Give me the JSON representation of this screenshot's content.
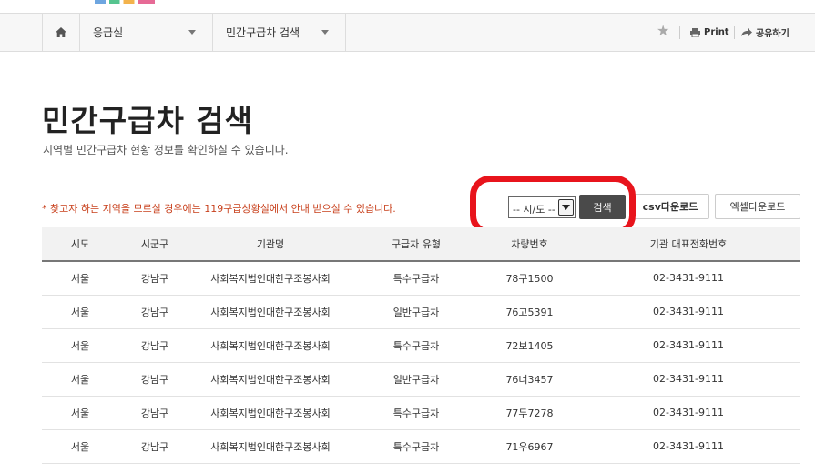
{
  "nav": {
    "home_icon": "home-icon",
    "dropdown1": "응급실",
    "dropdown2": "민간구급차 검색",
    "favorite_icon": "star-icon",
    "print_label": "Print",
    "share_label": "공유하기"
  },
  "page": {
    "title": "민간구급차 검색",
    "description": "지역별 민간구급차 현황 정보를 확인하실 수 있습니다."
  },
  "search": {
    "notice": "* 찾고자 하는 지역을 모르실 경우에는 119구급상황실에서 안내 받으실 수 있습니다.",
    "region_select": "-- 시/도 --",
    "search_label": "검색",
    "csv_label": "csv다운로드",
    "excel_label": "엑셀다운로드",
    "highlight_color": "#e8141c"
  },
  "table": {
    "headers": [
      "시도",
      "시군구",
      "기관명",
      "구급차 유형",
      "차량번호",
      "기관 대표전화번호"
    ],
    "rows": [
      [
        "서울",
        "강남구",
        "사회복지법인대한구조봉사회",
        "특수구급차",
        "78구1500",
        "02-3431-9111"
      ],
      [
        "서울",
        "강남구",
        "사회복지법인대한구조봉사회",
        "일반구급차",
        "76고5391",
        "02-3431-9111"
      ],
      [
        "서울",
        "강남구",
        "사회복지법인대한구조봉사회",
        "특수구급차",
        "72보1405",
        "02-3431-9111"
      ],
      [
        "서울",
        "강남구",
        "사회복지법인대한구조봉사회",
        "일반구급차",
        "76너3457",
        "02-3431-9111"
      ],
      [
        "서울",
        "강남구",
        "사회복지법인대한구조봉사회",
        "특수구급차",
        "77두7278",
        "02-3431-9111"
      ],
      [
        "서울",
        "강남구",
        "사회복지법인대한구조봉사회",
        "특수구급차",
        "71우6967",
        "02-3431-9111"
      ]
    ]
  }
}
